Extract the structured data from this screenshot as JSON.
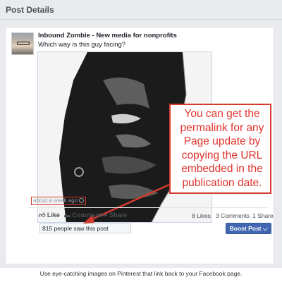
{
  "panel": {
    "title": "Post Details"
  },
  "post": {
    "page_name": "Inbound Zombie - New media for nonprofits",
    "text": "Which way is this guy facing?",
    "timestamp": "about a week ago",
    "callout": "You can get the permalink for any Page update by copying the URL embedded in the publication date."
  },
  "actions": {
    "like": "Like",
    "comment": "Comment",
    "share": "Share"
  },
  "stats": {
    "likes": "8 Likes",
    "comments": "3 Comments",
    "shares": "1 Share"
  },
  "reach": {
    "text": "815 people saw this post"
  },
  "boost": {
    "label": "Boost Post"
  },
  "caption": "Use eye-catching images on Pinterest that link back to your Facebook page.",
  "colors": {
    "callout_red": "#e0332b",
    "facebook_blue": "#4267b2",
    "panel_bg": "#e9ebee"
  }
}
